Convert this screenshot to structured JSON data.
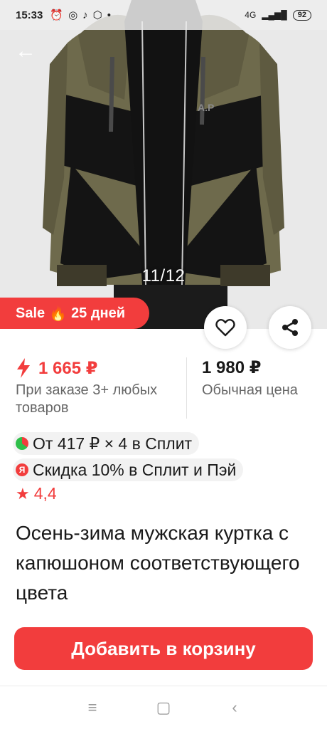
{
  "status_bar": {
    "time": "15:33",
    "icons": [
      "alarm-icon",
      "whatsapp-icon",
      "tiktok-icon",
      "box-icon",
      "dot-icon"
    ],
    "network": "4G",
    "battery": "92"
  },
  "gallery": {
    "counter": "11/12"
  },
  "sale_badge": {
    "label": "Sale",
    "icon": "fire-icon",
    "days": "25 дней"
  },
  "prices": {
    "promo_price": "1 665 ₽",
    "promo_note": "При заказе 3+ любых товаров",
    "regular_price": "1 980 ₽",
    "regular_note": "Обычная цена"
  },
  "offers": {
    "split": "От 417 ₽ × 4 в Сплит",
    "pay_discount": "Скидка 10% в Сплит и Пэй",
    "pay_icon_letter": "Я"
  },
  "rating": {
    "value": "4,4"
  },
  "product": {
    "title": "Осень-зима мужская куртка с капюшоном соответствующего цвета"
  },
  "actions": {
    "add_to_cart": "Добавить в корзину"
  },
  "colors": {
    "accent": "#f23d3d",
    "split_green": "#2fbf4a",
    "jacket_olive": "#6e6a4c",
    "jacket_black": "#141414"
  },
  "nav": {
    "icons": [
      "menu-icon",
      "home-icon",
      "back-icon"
    ]
  }
}
